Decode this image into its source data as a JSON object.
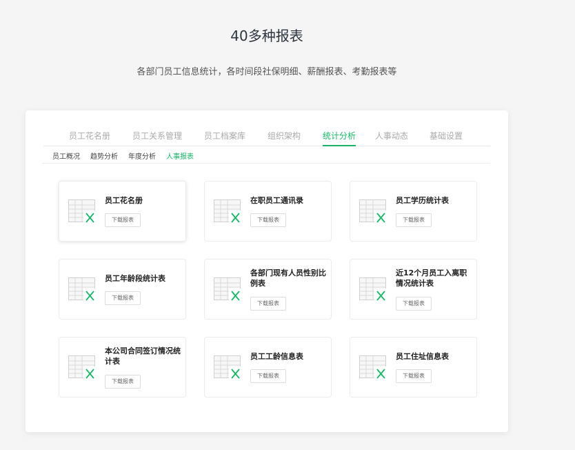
{
  "hero": {
    "title": "40多种报表",
    "subtitle": "各部门员工信息统计，各时间段社保明细、薪酬报表、考勤报表等"
  },
  "main_tabs": [
    "员工花名册",
    "员工关系管理",
    "员工档案库",
    "组织架构",
    "统计分析",
    "人事动态",
    "基础设置"
  ],
  "main_tab_active": "统计分析",
  "sub_tabs": [
    "员工概况",
    "趋势分析",
    "年度分析",
    "人事报表"
  ],
  "sub_tab_active": "人事报表",
  "reports": [
    {
      "name": "员工花名册",
      "button": "下载报表"
    },
    {
      "name": "在职员工通讯录",
      "button": "下载报表"
    },
    {
      "name": "员工学历统计表",
      "button": "下载报表"
    },
    {
      "name": "员工年龄段统计表",
      "button": "下载报表"
    },
    {
      "name": "各部门现有人员性别比例表",
      "button": "下载报表"
    },
    {
      "name": "近12个月员工入离职情况统计表",
      "button": "下载报表"
    },
    {
      "name": "本公司合同签订情况统计表",
      "button": "下载报表"
    },
    {
      "name": "员工工龄信息表",
      "button": "下载报表"
    },
    {
      "name": "员工住址信息表",
      "button": "下载报表"
    }
  ],
  "colors": {
    "accent": "#18b566",
    "text": "#222222",
    "muted": "#aaaaaa"
  },
  "icons": {
    "report": "excel-sheet-icon"
  }
}
